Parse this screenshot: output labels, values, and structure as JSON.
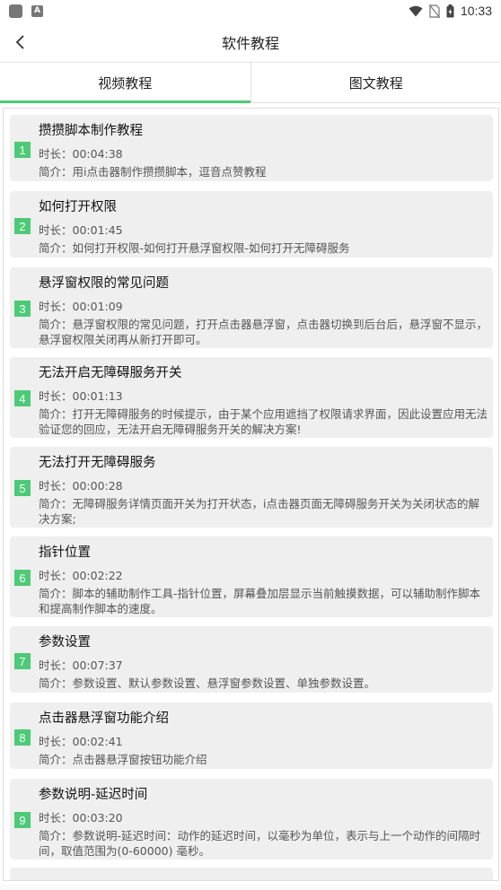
{
  "status_bar": {
    "time": "10:33",
    "icons": [
      "wifi-icon",
      "no-sim-icon",
      "battery-icon"
    ]
  },
  "header": {
    "title": "软件教程",
    "back_icon": "chevron-left-icon"
  },
  "tabs": [
    {
      "label": "视频教程",
      "active": true
    },
    {
      "label": "图文教程",
      "active": false
    }
  ],
  "tutorials": [
    {
      "index": "1",
      "title": "攒攒脚本制作教程",
      "duration": "时长：00:04:38",
      "intro": "简介：用i点击器制作攒攒脚本，逗音点赞教程"
    },
    {
      "index": "2",
      "title": "如何打开权限",
      "duration": "时长：00:01:45",
      "intro": "简介：如何打开权限-如何打开悬浮窗权限-如何打开无障碍服务"
    },
    {
      "index": "3",
      "title": "悬浮窗权限的常见问题",
      "duration": "时长：00:01:09",
      "intro": "简介：悬浮窗权限的常见问题，打开点击器悬浮窗，点击器切换到后台后，悬浮窗不显示，悬浮窗权限关闭再从新打开即可。"
    },
    {
      "index": "4",
      "title": "无法开启无障碍服务开关",
      "duration": "时长：00:01:13",
      "intro": "简介：打开无障碍服务的时候提示，由于某个应用遮挡了权限请求界面，因此设置应用无法验证您的回应，无法开启无障碍服务开关的解决方案!"
    },
    {
      "index": "5",
      "title": "无法打开无障碍服务",
      "duration": "时长：00:00:28",
      "intro": "简介：无障碍服务详情页面开关为打开状态，i点击器页面无障碍服务开关为关闭状态的解决方案;"
    },
    {
      "index": "6",
      "title": "指针位置",
      "duration": "时长：00:02:22",
      "intro": "简介：脚本的辅助制作工具-指针位置，屏幕叠加层显示当前触摸数据，可以辅助制作脚本和提高制作脚本的速度。"
    },
    {
      "index": "7",
      "title": "参数设置",
      "duration": "时长：00:07:37",
      "intro": "简介：参数设置、默认参数设置、悬浮窗参数设置、单独参数设置。"
    },
    {
      "index": "8",
      "title": "点击器悬浮窗功能介绍",
      "duration": "时长：00:02:41",
      "intro": "简介：点击器悬浮窗按钮功能介绍"
    },
    {
      "index": "9",
      "title": "参数说明-延迟时间",
      "duration": "时长：00:03:20",
      "intro": "简介：参数说明-延迟时间：动作的延迟时间，以毫秒为单位，表示与上一个动作的间隔时间，取值范围为(0-60000) 毫秒。"
    }
  ],
  "colors": {
    "accent": "#4cca76",
    "card_bg": "#efefef"
  }
}
